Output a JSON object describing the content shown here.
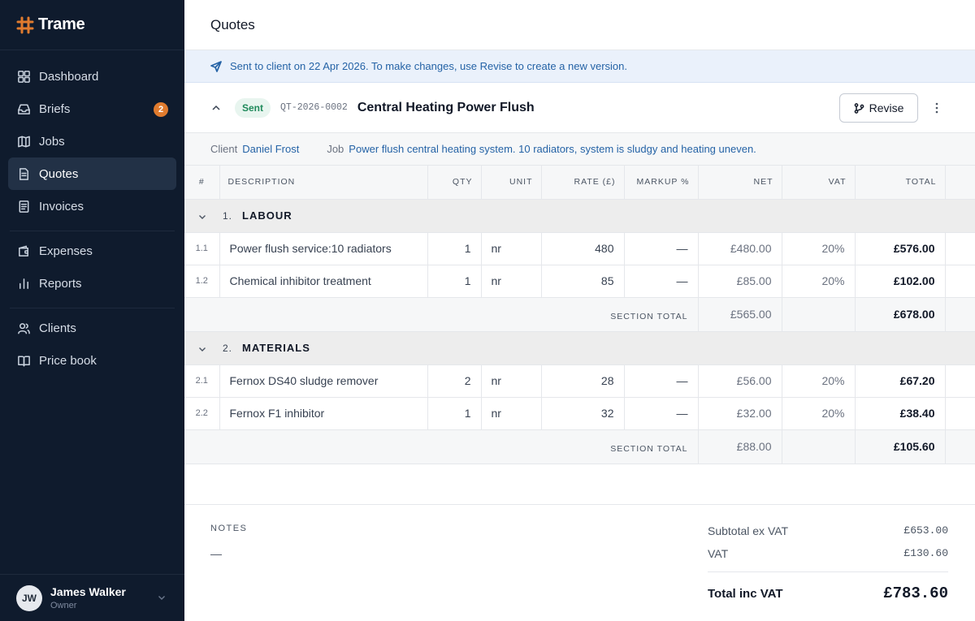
{
  "app": {
    "name": "Trame"
  },
  "sidebar": {
    "items": [
      {
        "label": "Dashboard",
        "icon": "grid-icon"
      },
      {
        "label": "Briefs",
        "icon": "inbox-icon",
        "badge": "2"
      },
      {
        "label": "Jobs",
        "icon": "map-icon"
      },
      {
        "label": "Quotes",
        "icon": "document-icon",
        "active": true
      },
      {
        "label": "Invoices",
        "icon": "invoice-icon"
      },
      {
        "label": "Expenses",
        "icon": "wallet-icon"
      },
      {
        "label": "Reports",
        "icon": "bar-chart-icon"
      },
      {
        "label": "Clients",
        "icon": "users-icon"
      },
      {
        "label": "Price book",
        "icon": "book-icon"
      }
    ],
    "user": {
      "initials": "JW",
      "name": "James Walker",
      "role": "Owner"
    }
  },
  "page": {
    "title": "Quotes"
  },
  "banner": {
    "text": "Sent to client on 22 Apr 2026. To make changes, use Revise to create a new version."
  },
  "quote": {
    "status": "Sent",
    "number": "QT-2026-0002",
    "title": "Central Heating Power Flush",
    "revise_label": "Revise",
    "client_label": "Client",
    "client": "Daniel Frost",
    "job_label": "Job",
    "job": "Power flush central heating system. 10 radiators, system is sludgy and heating uneven."
  },
  "table": {
    "headers": {
      "num": "#",
      "description": "DESCRIPTION",
      "qty": "QTY",
      "unit": "UNIT",
      "rate": "RATE (£)",
      "markup": "MARKUP %",
      "net": "NET",
      "vat": "VAT",
      "total": "TOTAL"
    },
    "section_total_label": "SECTION TOTAL",
    "sections": [
      {
        "index": "1.",
        "name": "LABOUR",
        "rows": [
          {
            "num": "1.1",
            "description": "Power flush service:10 radiators",
            "qty": "1",
            "unit": "nr",
            "rate": "480",
            "markup": "—",
            "net": "£480.00",
            "vat": "20%",
            "total": "£576.00"
          },
          {
            "num": "1.2",
            "description": "Chemical inhibitor treatment",
            "qty": "1",
            "unit": "nr",
            "rate": "85",
            "markup": "—",
            "net": "£85.00",
            "vat": "20%",
            "total": "£102.00"
          }
        ],
        "net_total": "£565.00",
        "total": "£678.00"
      },
      {
        "index": "2.",
        "name": "MATERIALS",
        "rows": [
          {
            "num": "2.1",
            "description": "Fernox DS40 sludge remover",
            "qty": "2",
            "unit": "nr",
            "rate": "28",
            "markup": "—",
            "net": "£56.00",
            "vat": "20%",
            "total": "£67.20"
          },
          {
            "num": "2.2",
            "description": "Fernox F1 inhibitor",
            "qty": "1",
            "unit": "nr",
            "rate": "32",
            "markup": "—",
            "net": "£32.00",
            "vat": "20%",
            "total": "£38.40"
          }
        ],
        "net_total": "£88.00",
        "total": "£105.60"
      }
    ]
  },
  "footer": {
    "notes_label": "NOTES",
    "notes": "—",
    "subtotal_label": "Subtotal ex VAT",
    "subtotal": "£653.00",
    "vat_label": "VAT",
    "vat": "£130.60",
    "grand_label": "Total inc VAT",
    "grand": "£783.60"
  }
}
